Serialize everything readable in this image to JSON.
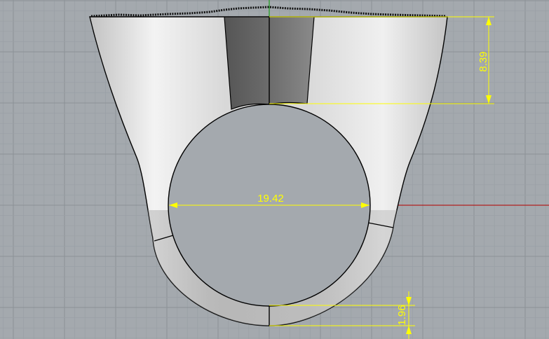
{
  "viewport": {
    "background": "#a4a9ae",
    "grid_minor_color": "#9aa0a5",
    "grid_major_color": "#8b9196",
    "x_axis_color": "#b02020",
    "y_axis_color": "#20a020"
  },
  "model": {
    "name": "ring",
    "outline_color": "#000000",
    "shank_color_light": "#f4f4f4",
    "shank_color_mid": "#c8c8c8",
    "center_band_color": "#6a6a6a"
  },
  "dimensions": {
    "color": "#ffff00",
    "top_height": "8.39",
    "inner_diameter": "19.42",
    "band_thickness": "1.96"
  }
}
